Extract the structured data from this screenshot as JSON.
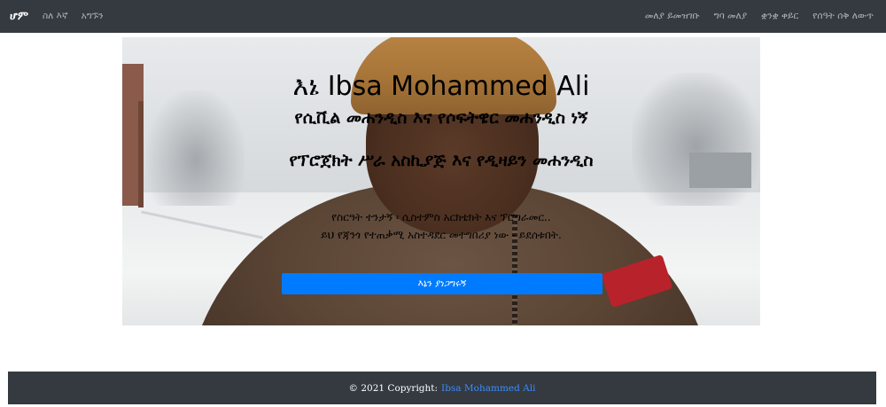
{
  "navbar": {
    "brand": "ሆም",
    "left_links": [
      {
        "label": "ስለ እኛ"
      },
      {
        "label": "አግኙን"
      }
    ],
    "right_links": [
      {
        "label": "መለያ ይመዝገቡ"
      },
      {
        "label": "ግባ መለያ"
      },
      {
        "label": "ቋንቋ ቀይር"
      },
      {
        "label": "የሰዓት ሰቅ ለውጥ"
      }
    ]
  },
  "hero": {
    "title": "እኔ Ibsa Mohammed Ali",
    "subtitle_1": "የሲቪል መሐንዲስ እና የሶፍትዌር መሐንዲስ ነኝ",
    "subtitle_2": "የፕሮጀክት ሥራ አስኪያጅ እና የዲዛይን መሐንዲስ",
    "paragraph_line_1": "የስርዓት ተንታኝ ፡ ሲስተምስ አርክቴክት እና ፕሮግራመር..",
    "paragraph_line_2": "ይህ የጃንጎ የተጠቃሚ አስተዳደር መተግበሪያ ነው - ይደሰቱበት.",
    "button_label": "እኔን ያነጋግሩኝ"
  },
  "footer": {
    "copyright": "© 2021 Copyright:",
    "author_link": "Ibsa Mohammed Ali"
  },
  "colors": {
    "navbar_bg": "#343a40",
    "primary": "#007bff",
    "link": "#3d8bfd"
  }
}
